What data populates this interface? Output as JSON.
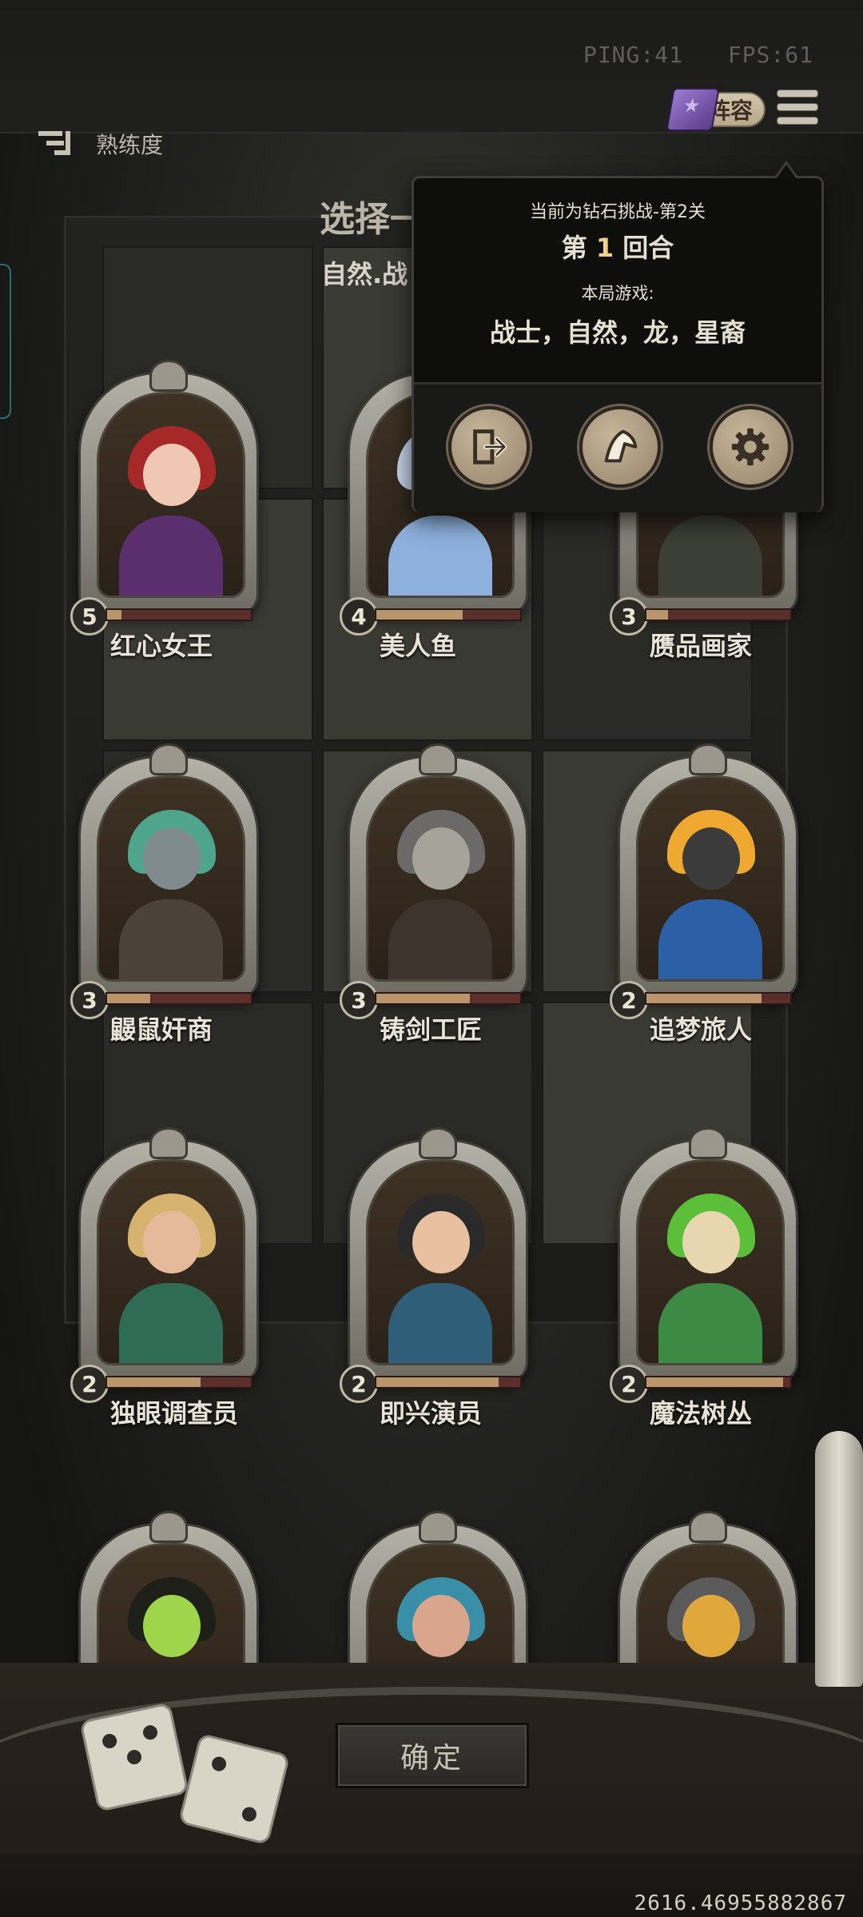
{
  "status": {
    "ping": "PING:41",
    "fps": "FPS:61"
  },
  "header": {
    "lineup_label": "阵容",
    "proficiency_label": "熟练度"
  },
  "board": {
    "title": "选择一",
    "subtitle": "自然.战"
  },
  "heroes": [
    {
      "name": "红心女王",
      "level": "5",
      "progress": 0.1,
      "palette": {
        "hair": "#a62828",
        "skin": "#f0c7b2",
        "body": "#5b2f6e"
      }
    },
    {
      "name": "美人鱼",
      "level": "4",
      "progress": 0.6,
      "palette": {
        "hair": "#c9d8ec",
        "skin": "#f2e4dc",
        "body": "#8db1dc"
      }
    },
    {
      "name": "赝品画家",
      "level": "3",
      "progress": 0.15,
      "palette": {
        "hair": "#5f6b5f",
        "skin": "#cbb79a",
        "body": "#3b3f36"
      }
    },
    {
      "name": "鼹鼠奸商",
      "level": "3",
      "progress": 0.3,
      "palette": {
        "hair": "#4fa58b",
        "skin": "#7f8a8c",
        "body": "#4b4238"
      }
    },
    {
      "name": "铸剑工匠",
      "level": "3",
      "progress": 0.65,
      "palette": {
        "hair": "#6b6a68",
        "skin": "#a6a39b",
        "body": "#3d352d"
      }
    },
    {
      "name": "追梦旅人",
      "level": "2",
      "progress": 0.8,
      "palette": {
        "hair": "#f0a930",
        "skin": "#3b3b3b",
        "body": "#2c5fa6"
      }
    },
    {
      "name": "独眼调查员",
      "level": "2",
      "progress": 0.65,
      "palette": {
        "hair": "#d6b470",
        "skin": "#e6b99a",
        "body": "#2f6b55"
      }
    },
    {
      "name": "即兴演员",
      "level": "2",
      "progress": 0.85,
      "palette": {
        "hair": "#2a2a2a",
        "skin": "#e8c0a0",
        "body": "#2f5f78"
      }
    },
    {
      "name": "魔法树丛",
      "level": "2",
      "progress": 0.95,
      "palette": {
        "hair": "#5cbf3a",
        "skin": "#e8d6b0",
        "body": "#3d8a45"
      }
    },
    {
      "name": "",
      "level": "",
      "progress": 0,
      "palette": {
        "hair": "#1f1f1a",
        "skin": "#9ed54a",
        "body": "#121210"
      }
    },
    {
      "name": "",
      "level": "",
      "progress": 0,
      "palette": {
        "hair": "#3a8fa8",
        "skin": "#d9a58c",
        "body": "#2e5a7a"
      }
    },
    {
      "name": "",
      "level": "",
      "progress": 0,
      "palette": {
        "hair": "#5a5a5a",
        "skin": "#e0a83a",
        "body": "#3a3a3a"
      }
    }
  ],
  "popup": {
    "challenge": "当前为钻石挑战-第2关",
    "round_prefix": "第",
    "round_number": "1",
    "round_suffix": "回合",
    "game_label": "本局游戏:",
    "traits": "战士，自然，龙，星裔",
    "buttons": [
      "exit-icon",
      "hint-icon",
      "gear-icon"
    ]
  },
  "confirm_label": "确定",
  "coordinates": "2616.46955882867"
}
